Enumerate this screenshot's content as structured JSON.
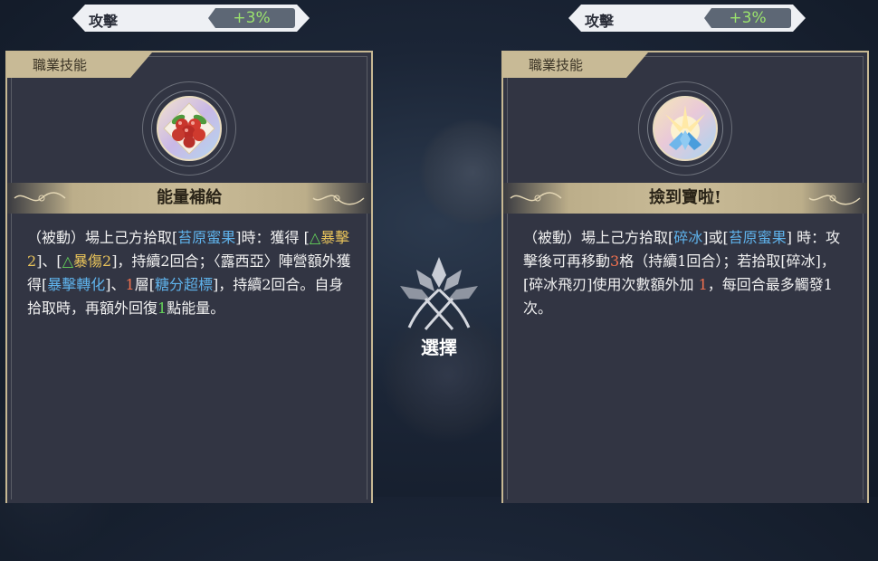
{
  "stats": [
    {
      "label": "攻擊",
      "value": "+3%"
    },
    {
      "label": "攻擊",
      "value": "+3%"
    }
  ],
  "cards": [
    {
      "tag": "職業技能",
      "title": "能量補給",
      "icon": "berries-icon",
      "desc": [
        {
          "t": "（被動）場上己方拾取["
        },
        {
          "t": "苔原蜜果",
          "c": "blue"
        },
        {
          "t": "]時：獲得 ["
        },
        {
          "t": "△",
          "c": "green"
        },
        {
          "t": "暴擊2",
          "c": "gold"
        },
        {
          "t": "]、["
        },
        {
          "t": "△",
          "c": "green"
        },
        {
          "t": "暴傷2",
          "c": "gold"
        },
        {
          "t": "]，持續2回合；〈露西亞〉陣營額外獲得["
        },
        {
          "t": "暴擊轉化",
          "c": "blue"
        },
        {
          "t": "]、"
        },
        {
          "t": "1",
          "c": "red"
        },
        {
          "t": "層["
        },
        {
          "t": "糖分超標",
          "c": "blue"
        },
        {
          "t": "]，持續2回合。自身拾取時，再額外回復"
        },
        {
          "t": "1",
          "c": "green"
        },
        {
          "t": "點能量。"
        }
      ]
    },
    {
      "tag": "職業技能",
      "title": "撿到寶啦!",
      "icon": "ice-crystal-icon",
      "desc": [
        {
          "t": "（被動）場上己方拾取["
        },
        {
          "t": "碎冰",
          "c": "blue"
        },
        {
          "t": "]或["
        },
        {
          "t": "苔原蜜果",
          "c": "blue"
        },
        {
          "t": "] 時：攻擊後可再移動"
        },
        {
          "t": "3",
          "c": "red"
        },
        {
          "t": "格（持續1回合）；若拾取[碎冰]，[碎冰飛刃]使用次數額外加 "
        },
        {
          "t": "1",
          "c": "red"
        },
        {
          "t": "，每回合最多觸發1次。"
        }
      ]
    }
  ],
  "select": {
    "label": "選擇",
    "icon": "tree-emblem-icon"
  }
}
